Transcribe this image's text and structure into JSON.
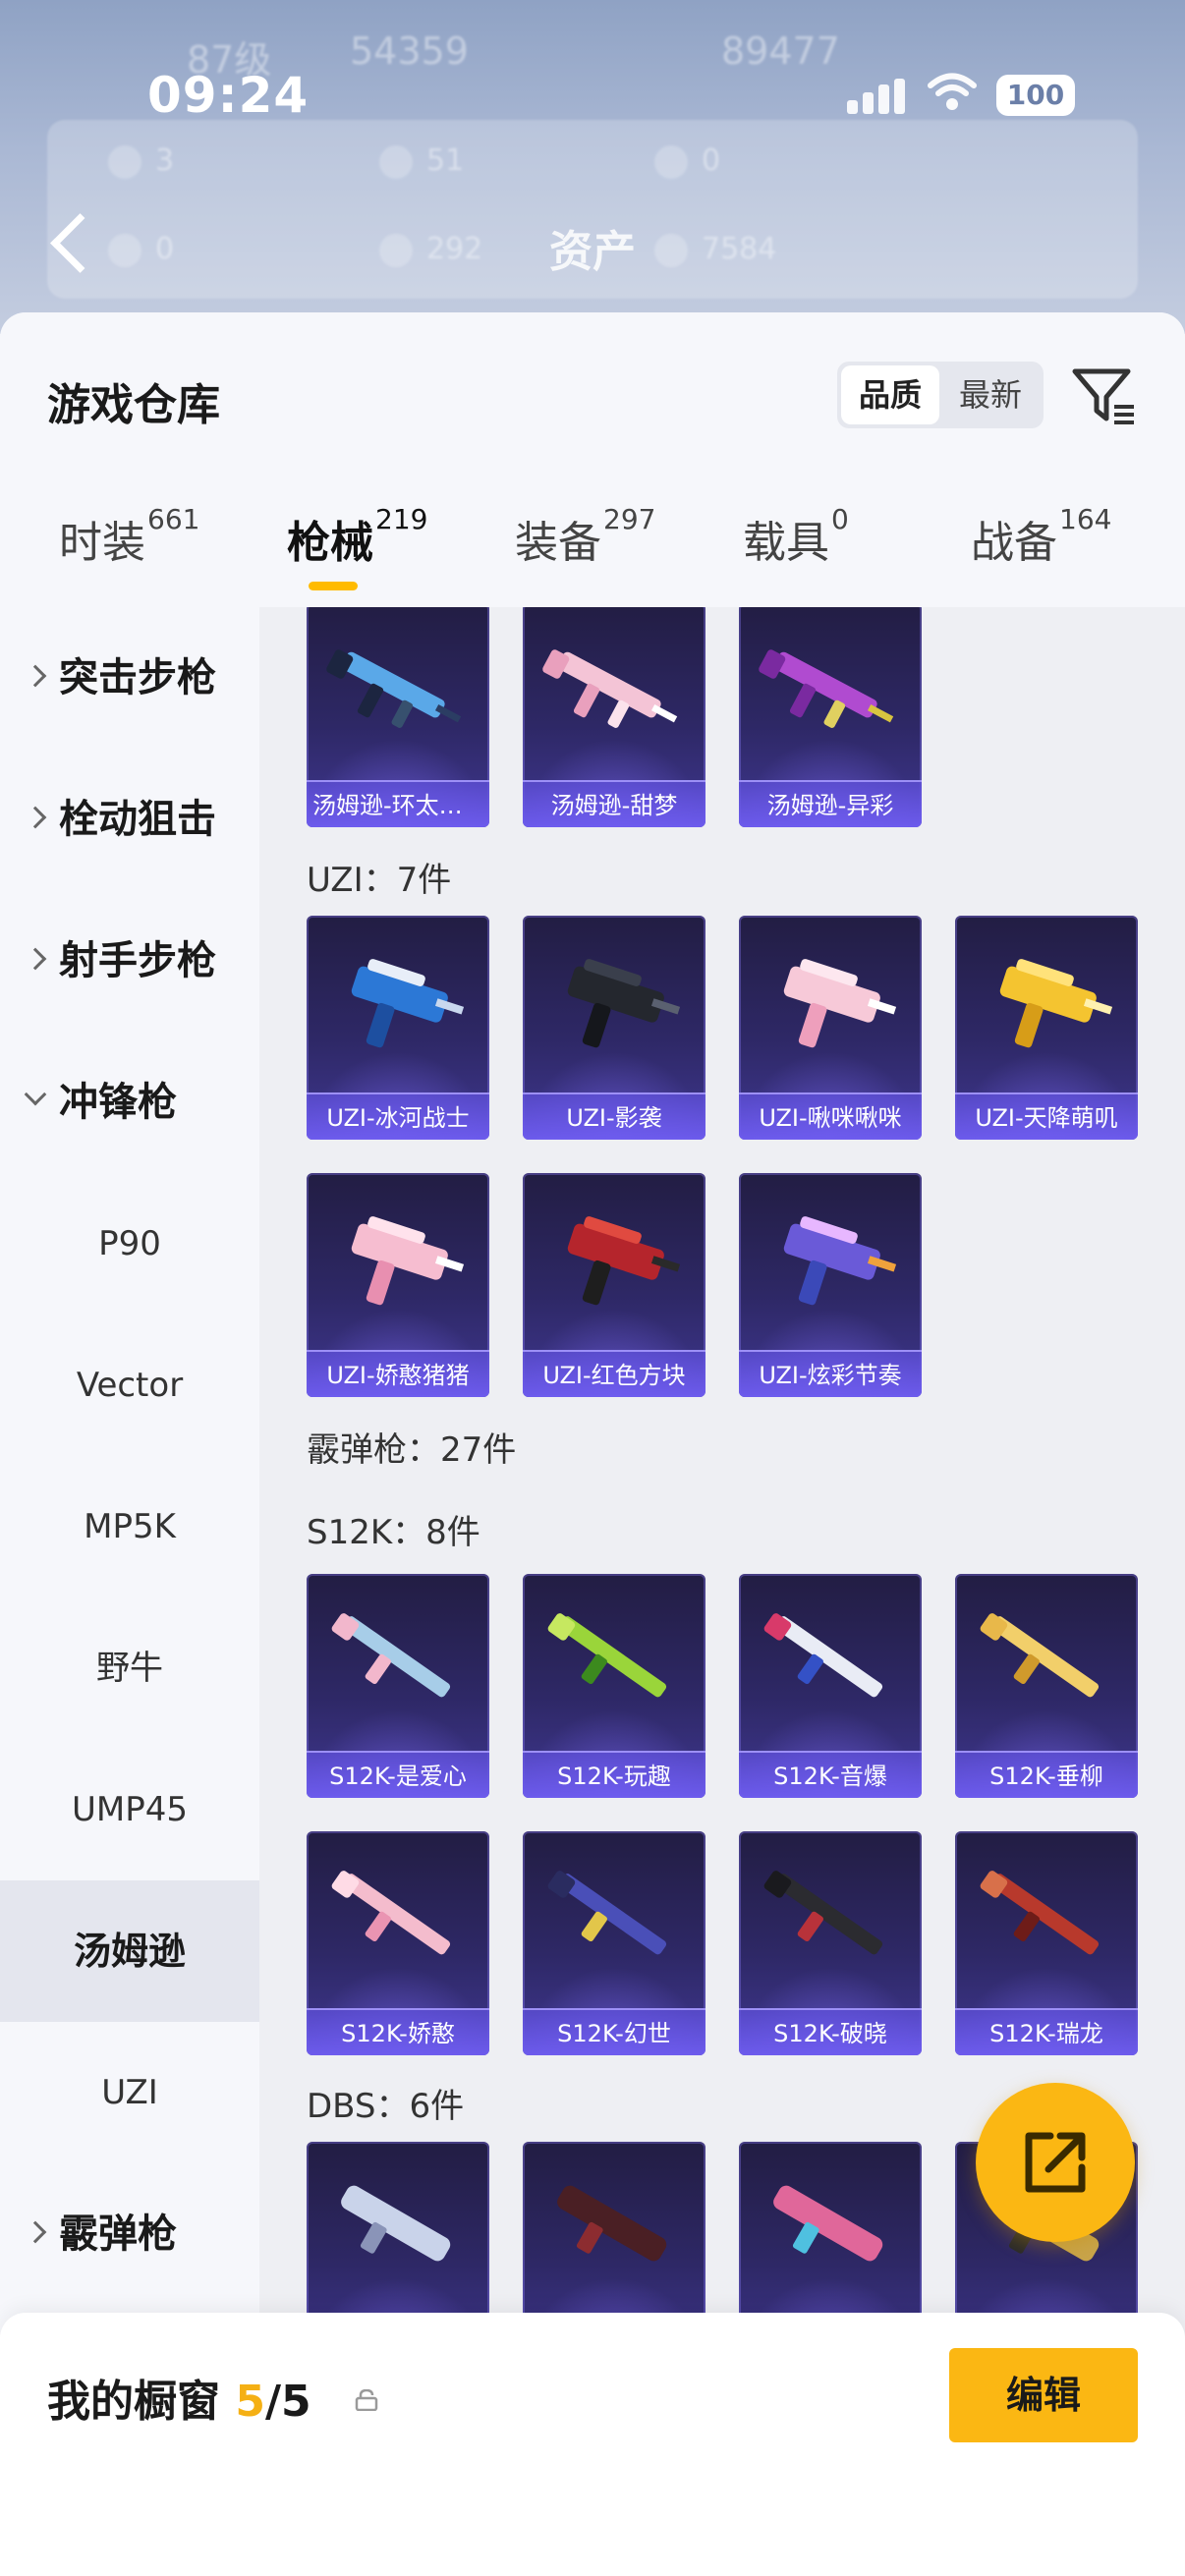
{
  "status_bar": {
    "time": "09:24",
    "battery": "100"
  },
  "header": {
    "title": "资产",
    "blurred": {
      "level": "87级",
      "coins": "54359",
      "score": "89477",
      "stats": [
        "3",
        "51",
        "0",
        "0",
        "292",
        "7584"
      ]
    }
  },
  "warehouse": {
    "title": "游戏仓库",
    "sort": {
      "quality": "品质",
      "newest": "最新"
    }
  },
  "tabs": [
    {
      "label": "时装",
      "count": "661"
    },
    {
      "label": "枪械",
      "count": "219"
    },
    {
      "label": "装备",
      "count": "297"
    },
    {
      "label": "载具",
      "count": "0"
    },
    {
      "label": "战备",
      "count": "164"
    }
  ],
  "sidebar": {
    "categories": [
      "突击步枪",
      "栓动狙击",
      "射手步枪",
      "冲锋枪"
    ],
    "subs": [
      "P90",
      "Vector",
      "MP5K",
      "野牛",
      "UMP45",
      "汤姆逊",
      "UZI"
    ],
    "last_category": "霰弹枪"
  },
  "grid": {
    "thompson_cards": [
      "汤姆逊-环太平洋",
      "汤姆逊-甜梦",
      "汤姆逊-异彩"
    ],
    "uzi_header": "UZI：7件",
    "uzi_cards": [
      "UZI-冰河战士",
      "UZI-影袭",
      "UZI-啾咪啾咪",
      "UZI-天降萌叽",
      "UZI-娇憨猪猪",
      "UZI-红色方块",
      "UZI-炫彩节奏"
    ],
    "shotgun_header": "霰弹枪：27件",
    "s12k_header": "S12K：8件",
    "s12k_cards": [
      "S12K-是爱心",
      "S12K-玩趣",
      "S12K-音爆",
      "S12K-垂柳",
      "S12K-娇憨",
      "S12K-幻世",
      "S12K-破晓",
      "S12K-瑞龙"
    ],
    "dbs_header": "DBS：6件",
    "dbs_cards": [
      "",
      "",
      "",
      ""
    ]
  },
  "bottom": {
    "title": "我的橱窗",
    "current": "5",
    "sep_total": "/5",
    "edit": "编辑"
  },
  "colors": {
    "accent": "#fbb713",
    "card_dark": "#221d43",
    "card_light": "#3f3790",
    "label_bar": "#6e5cf0"
  },
  "icons": {
    "back": "chevron-left-icon",
    "filter": "filter-icon",
    "share": "share-export-icon",
    "lock": "lock-icon"
  }
}
